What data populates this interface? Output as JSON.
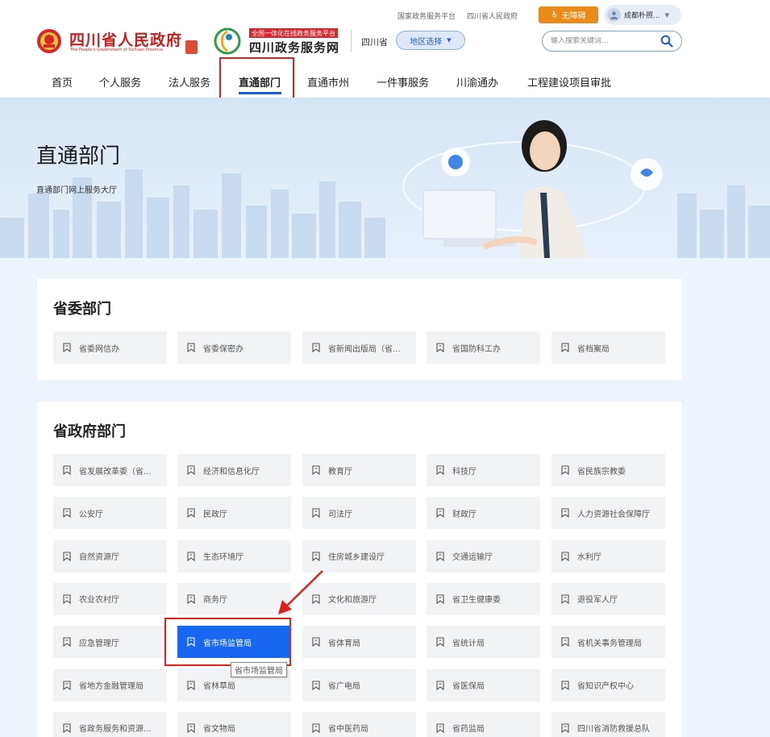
{
  "header": {
    "top_links": [
      "国家政务服务平台",
      "四川省人民政府"
    ],
    "accessibility_label": "无障碍",
    "user_name": "成都朴照...",
    "gov_title": "四川省人民政府",
    "gov_subtitle": "The People's Government of Sichuan Province",
    "service_banner": "全国一体化在线政务服务平台",
    "service_title": "四川政务服务网",
    "province": "四川省",
    "region_select_label": "地区选择",
    "search_placeholder": "输入搜索关键词..."
  },
  "nav": {
    "items": [
      "首页",
      "个人服务",
      "法人服务",
      "直通部门",
      "直通市州",
      "一件事服务",
      "川渝通办",
      "工程建设项目审批"
    ],
    "active_index": 3
  },
  "banner": {
    "title": "直通部门",
    "subtitle": "直通部门网上服务大厅"
  },
  "sections": [
    {
      "title": "省委部门",
      "items": [
        "省委网信办",
        "省委保密办",
        "省新闻出版局（省...",
        "省国防科工办",
        "省档案局"
      ]
    },
    {
      "title": "省政府部门",
      "items": [
        "省发展改革委（省...",
        "经济和信息化厅",
        "教育厅",
        "科技厅",
        "省民族宗教委",
        "公安厅",
        "民政厅",
        "司法厅",
        "财政厅",
        "人力资源社会保障厅",
        "自然资源厅",
        "生态环境厅",
        "住房城乡建设厅",
        "交通运输厅",
        "水利厅",
        "农业农村厅",
        "商务厅",
        "文化和旅游厅",
        "省卫生健康委",
        "退役军人厅",
        "应急管理厅",
        "省市场监管局",
        "省体育局",
        "省统计局",
        "省机关事务管理局",
        "省地方金融管理局",
        "省林草局",
        "省广电局",
        "省医保局",
        "省知识产权中心",
        "省政务服务和资源...",
        "省文物局",
        "省中医药局",
        "省药监局",
        "四川省消防救援总队"
      ],
      "active_item": "省市场监管局"
    }
  ],
  "tooltip": "省市场监管局",
  "colors": {
    "accent": "#1767f0",
    "gov_red": "#c81d1d",
    "highlight_red": "#e0201c",
    "accessibility_orange": "#e98a1a"
  }
}
